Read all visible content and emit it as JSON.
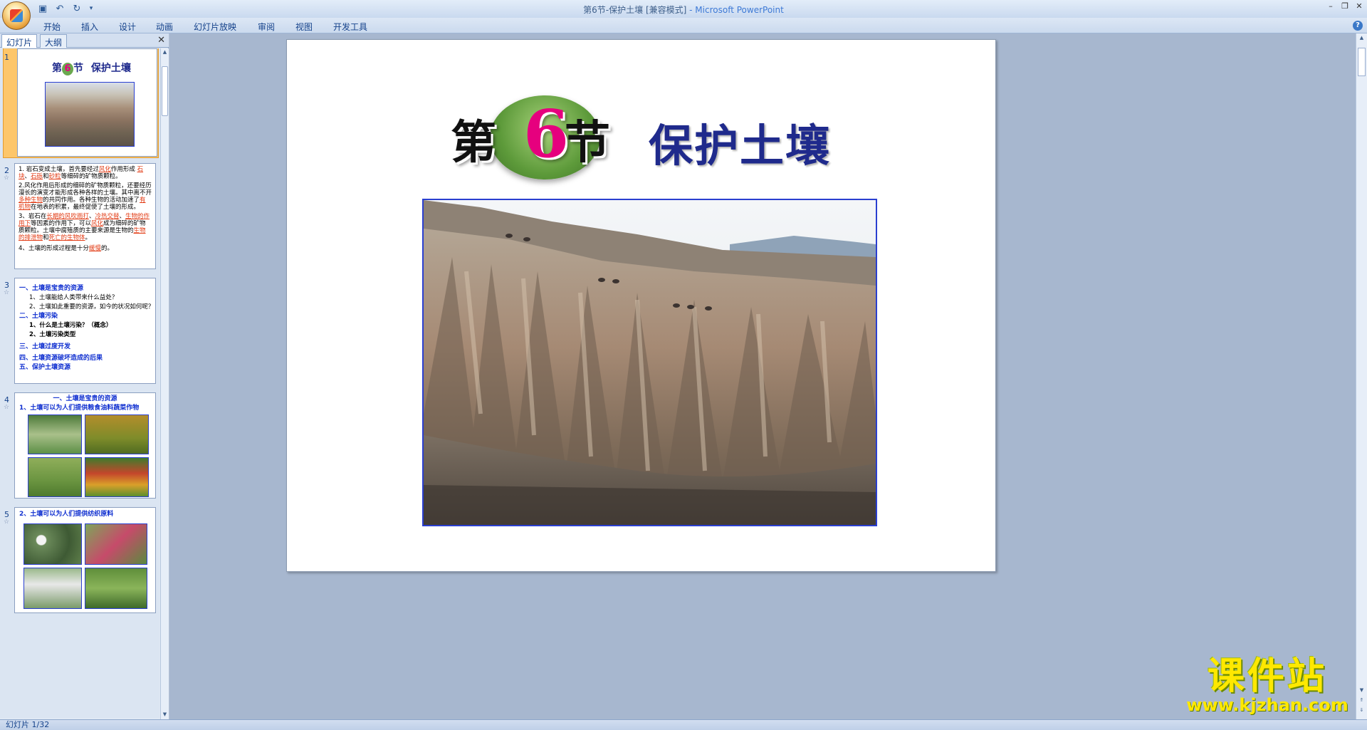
{
  "window": {
    "title": "第6节-保护土壤 [兼容模式]",
    "app_name": "- Microsoft PowerPoint"
  },
  "menu": {
    "tabs": [
      "开始",
      "插入",
      "设计",
      "动画",
      "幻灯片放映",
      "审阅",
      "视图",
      "开发工具"
    ]
  },
  "panel": {
    "tabs": [
      "幻灯片",
      "大纲"
    ],
    "close": "✕"
  },
  "thumbnails": {
    "s1": {
      "num": "1",
      "title_num": "6",
      "title_a": "第",
      "title_b": "节",
      "title_c": "保护土壤"
    },
    "s2": {
      "num": "2",
      "p1": "1. 岩石变成土壤，首先要经过",
      "p1r": "风化",
      "p1b": "作用形成",
      "p1c": "石块",
      "p1d": "、",
      "p1e": "石砾",
      "p1f": "和",
      "p1g": "砂粒",
      "p1h": "等细碎的矿物质颗粒。",
      "p2": "2.风化作用后形成的细碎的矿物质颗粒，还要经历漫长的演变才能形成各种各样的土壤。其中离不开",
      "p2r": "多种生物",
      "p2b": "的共同作用。各种生物的活动加速了",
      "p2c": "有机物",
      "p2d": "在地表的积累，最终促使了土壤的形成。",
      "p3": "3、岩石在",
      "p3r": "长期的风吹雨打",
      "p3b": "、",
      "p3c": "冷热交替",
      "p3d": "、",
      "p3e": "生物的作用下",
      "p3f": "等因素的作用下，可以",
      "p3g": "风化",
      "p3h": "成为细碎的矿物质颗粒。土壤中腐殖质的主要来源是生物的",
      "p3i": "生物的排泄物",
      "p3j": "和",
      "p3k": "死亡的生物体",
      "p3l": "。",
      "p4": "4、土壤的形成过程是十分",
      "p4r": "缓慢",
      "p4b": "的。"
    },
    "s3": {
      "num": "3",
      "items": [
        "一、土壤是宝贵的资源",
        "1、土壤能给人类带来什么益处？",
        "2、土壤如此重要的资源，如今的状况如何呢？",
        "二、土壤污染",
        "1、什么是土壤污染？（概念）",
        "2、土壤污染类型",
        "三、土壤过度开发",
        "四、土壤资源破坏造成的后果",
        "五、保护土壤资源"
      ]
    },
    "s4": {
      "num": "4",
      "title": "一、土壤是宝贵的资源",
      "sub": "1、土壤可以为人们提供粮食油料蔬菜作物"
    },
    "s5": {
      "num": "5",
      "sub": "2、土壤可以为人们提供纺织原料"
    }
  },
  "slide": {
    "title_a": "第",
    "title_num": "6",
    "title_b": "节",
    "title_c": "保护土壤"
  },
  "status": {
    "slide_counter": "幻灯片 1/32"
  },
  "watermark": {
    "cn": "课件站",
    "url": "www.kjzhan.com"
  },
  "colors": {
    "slide_title_blue": "#1f2a8c",
    "highlight_red": "#e23b14",
    "outline_blue": "#0f2fd0",
    "watermark_yellow": "#ffe800"
  }
}
